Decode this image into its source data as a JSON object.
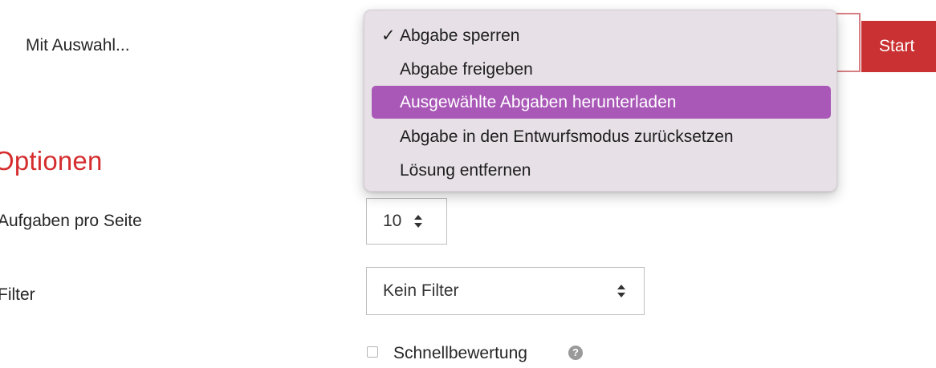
{
  "colors": {
    "accent": "#ca3132",
    "heading": "#d52d2e",
    "highlight": "#a958b7",
    "dropdown_bg": "#e7e1e7"
  },
  "bulk_action": {
    "label": "Mit Auswahl...",
    "start_label": "Start"
  },
  "dropdown": {
    "selected_mark": "✓",
    "items": [
      {
        "label": "Abgabe sperren"
      },
      {
        "label": "Abgabe freigeben"
      },
      {
        "label": "Ausgewählte Abgaben herunterladen"
      },
      {
        "label": "Abgabe in den Entwurfsmodus zurücksetzen"
      },
      {
        "label": "Lösung entfernen"
      }
    ]
  },
  "options": {
    "heading": "Optionen",
    "per_page_label": "Aufgaben pro Seite",
    "per_page_value": "10",
    "filter_label": "Filter",
    "filter_value": "Kein Filter",
    "quickgrading_label": "Schnellbewertung",
    "quickgrading_checked": false,
    "help_icon": "question-circle-icon",
    "help_glyph": "?"
  }
}
